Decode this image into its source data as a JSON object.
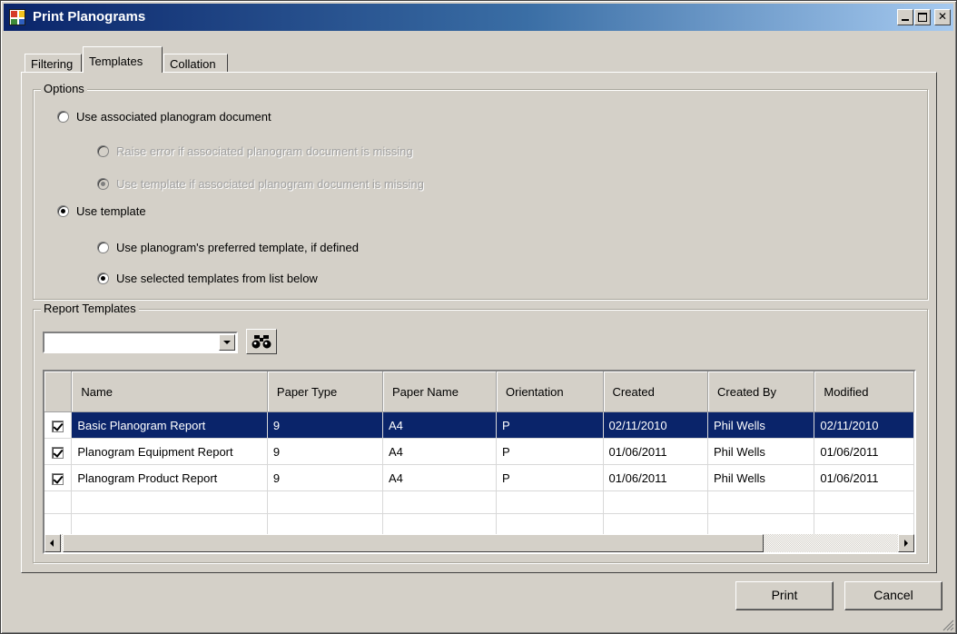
{
  "window": {
    "title": "Print Planograms"
  },
  "tabs": [
    {
      "label": "Filtering"
    },
    {
      "label": "Templates"
    },
    {
      "label": "Collation"
    }
  ],
  "options": {
    "legend": "Options",
    "use_associated": "Use associated planogram document",
    "raise_error": "Raise error if associated planogram document is missing",
    "use_template_if_missing": "Use template if associated planogram document is missing",
    "use_template": "Use template",
    "use_preferred": "Use planogram's preferred template, if defined",
    "use_selected": "Use selected templates from list below"
  },
  "report_templates": {
    "legend": "Report Templates",
    "combo_value": "",
    "columns": [
      "Name",
      "Paper Type",
      "Paper Name",
      "Orientation",
      "Created",
      "Created By",
      "Modified"
    ],
    "rows": [
      {
        "checked": true,
        "name": "Basic Planogram Report",
        "paper_type": "9",
        "paper_name": "A4",
        "orientation": "P",
        "created": "02/11/2010",
        "created_by": "Phil Wells",
        "modified": "02/11/2010"
      },
      {
        "checked": true,
        "name": "Planogram Equipment Report",
        "paper_type": "9",
        "paper_name": "A4",
        "orientation": "P",
        "created": "01/06/2011",
        "created_by": "Phil Wells",
        "modified": "01/06/2011"
      },
      {
        "checked": true,
        "name": "Planogram Product Report",
        "paper_type": "9",
        "paper_name": "A4",
        "orientation": "P",
        "created": "01/06/2011",
        "created_by": "Phil Wells",
        "modified": "01/06/2011"
      }
    ]
  },
  "buttons": {
    "print": "Print",
    "cancel": "Cancel"
  },
  "colors": {
    "selection": "#0a246a",
    "face": "#d4d0c8"
  }
}
